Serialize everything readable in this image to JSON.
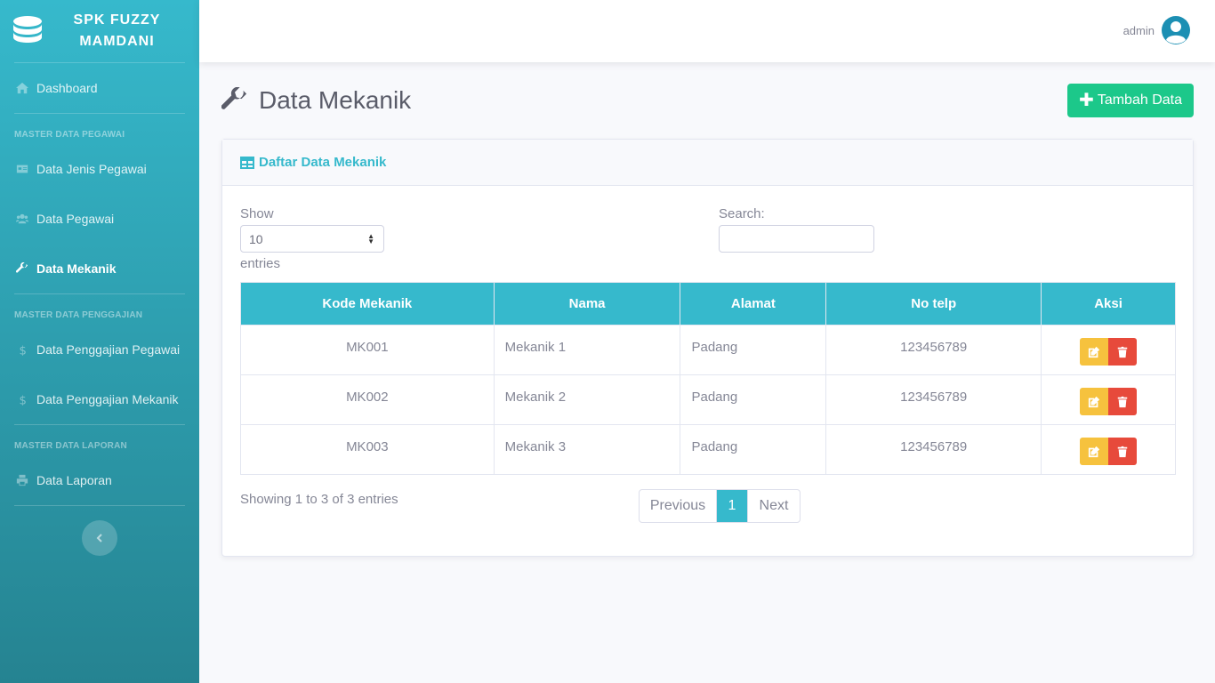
{
  "brand": {
    "line1": "SPK FUZZY",
    "line2": "MAMDANI"
  },
  "sidebar": {
    "dashboard": "Dashboard",
    "heading_pegawai": "MASTER DATA PEGAWAI",
    "jenis_pegawai": "Data Jenis Pegawai",
    "pegawai": "Data Pegawai",
    "mekanik": "Data Mekanik",
    "heading_penggajian": "MASTER DATA PENGGAJIAN",
    "penggajian_pegawai": "Data Penggajian Pegawai",
    "penggajian_mekanik": "Data Penggajian Mekanik",
    "heading_laporan": "MASTER DATA LAPORAN",
    "laporan": "Data Laporan"
  },
  "topbar": {
    "user_name": "admin"
  },
  "page": {
    "title": "Data Mekanik",
    "add_button": "Tambah Data"
  },
  "card": {
    "title": "Daftar Data Mekanik"
  },
  "datatable": {
    "show_label": "Show",
    "page_size": "10",
    "entries_label": "entries",
    "search_label": "Search:",
    "info": "Showing 1 to 3 of 3 entries",
    "prev": "Previous",
    "current_page": "1",
    "next": "Next"
  },
  "table": {
    "headers": [
      "Kode Mekanik",
      "Nama",
      "Alamat",
      "No telp",
      "Aksi"
    ],
    "rows": [
      {
        "kode": "MK001",
        "nama": "Mekanik 1",
        "alamat": "Padang",
        "telp": "123456789"
      },
      {
        "kode": "MK002",
        "nama": "Mekanik 2",
        "alamat": "Padang",
        "telp": "123456789"
      },
      {
        "kode": "MK003",
        "nama": "Mekanik 3",
        "alamat": "Padang",
        "telp": "123456789"
      }
    ]
  },
  "colors": {
    "primary": "#36b9cc",
    "success": "#1cc88a",
    "warning": "#f6c23e",
    "danger": "#e74a3b"
  }
}
